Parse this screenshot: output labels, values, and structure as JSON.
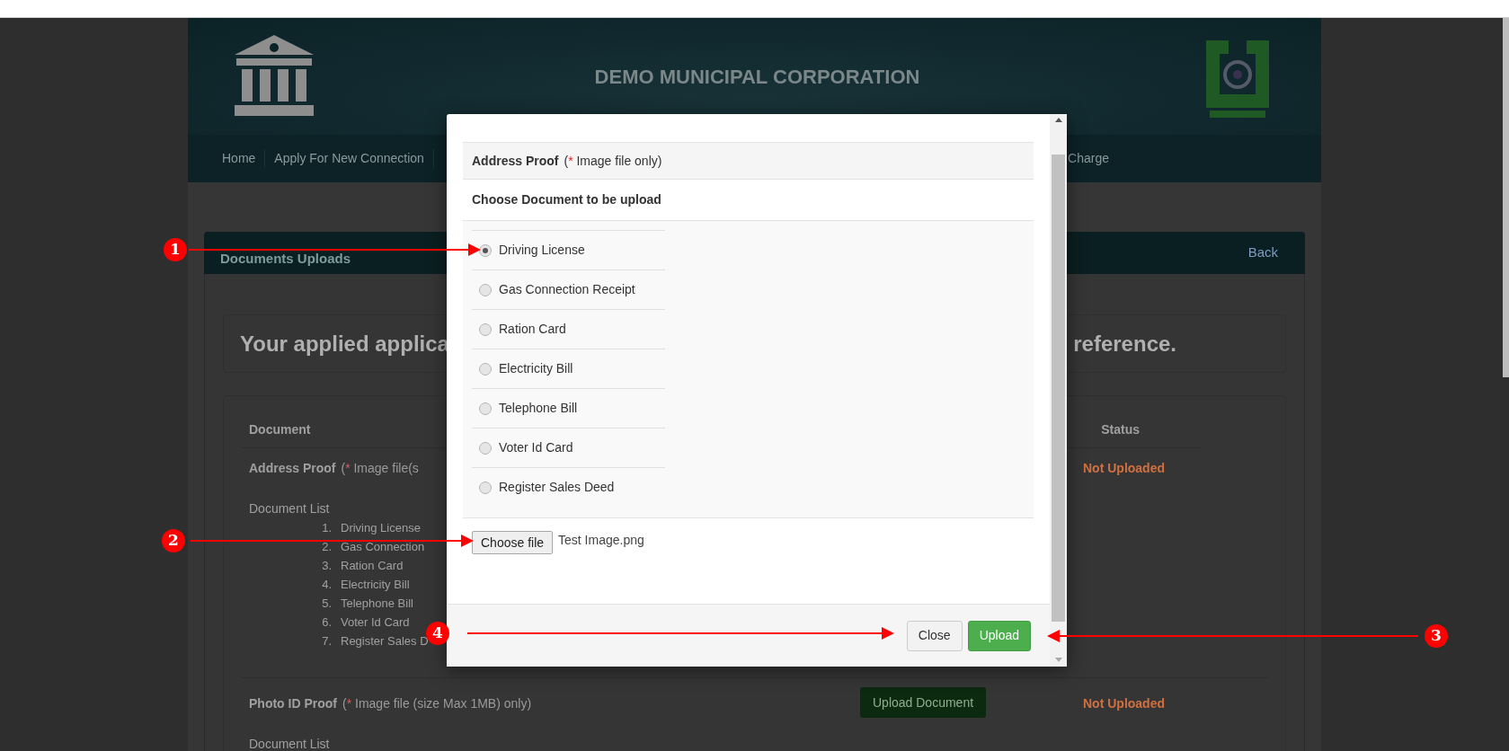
{
  "header": {
    "title": "DEMO MUNICIPAL CORPORATION",
    "nav_left": [
      "Home",
      "Apply For New Connection"
    ],
    "nav_right": [
      "Charge"
    ]
  },
  "panel": {
    "title": "Documents Uploads",
    "back": "Back",
    "message_start": "Your applied applica",
    "message_end": "reference.",
    "columns": [
      "Document",
      "Status"
    ],
    "rows": [
      {
        "name": "Address Proof",
        "note_open": "(",
        "note_mark": "*",
        "note_text": "Image file(s",
        "list_label": "Document List",
        "items": [
          {
            "number": "1.",
            "label": "Driving License"
          },
          {
            "number": "2.",
            "label": "Gas Connection"
          },
          {
            "number": "3.",
            "label": "Ration Card"
          },
          {
            "number": "4.",
            "label": "Electricity Bill"
          },
          {
            "number": "5.",
            "label": "Telephone Bill"
          },
          {
            "number": "6.",
            "label": "Voter Id Card"
          },
          {
            "number": "7.",
            "label": "Register Sales D"
          }
        ],
        "status": "Not Uploaded"
      },
      {
        "name": "Photo ID Proof",
        "note_open": "(",
        "note_mark": "*",
        "note_text": "Image file (size Max 1MB) only)",
        "list_label": "Document List",
        "action": "Upload Document",
        "status": "Not Uploaded"
      }
    ]
  },
  "modal": {
    "section": "Address Proof",
    "note_open": "(",
    "note_mark": "*",
    "note_text": "Image file only)",
    "prompt": "Choose Document to be upload",
    "options": [
      {
        "label": "Driving License",
        "selected": true
      },
      {
        "label": "Gas Connection Receipt",
        "selected": false
      },
      {
        "label": "Ration Card",
        "selected": false
      },
      {
        "label": "Electricity Bill",
        "selected": false
      },
      {
        "label": "Telephone Bill",
        "selected": false
      },
      {
        "label": "Voter Id Card",
        "selected": false
      },
      {
        "label": "Register Sales Deed",
        "selected": false
      }
    ],
    "file_button": "Choose file",
    "file_name": "Test Image.png",
    "buttons": [
      {
        "label": "Close",
        "kind": "default"
      },
      {
        "label": "Upload",
        "kind": "primary"
      }
    ]
  },
  "annotations": [
    {
      "number": "1"
    },
    {
      "number": "2"
    },
    {
      "number": "4"
    },
    {
      "number": "3"
    }
  ]
}
